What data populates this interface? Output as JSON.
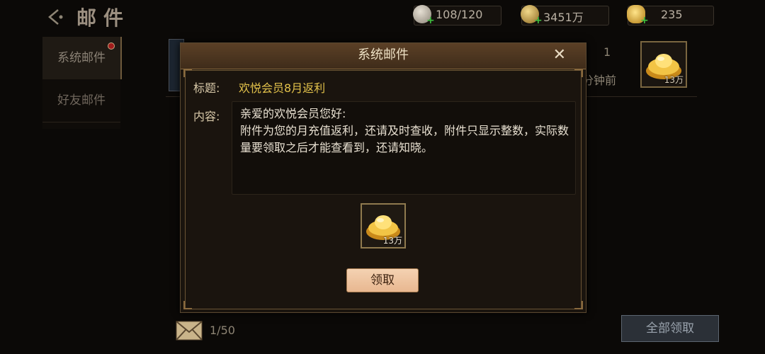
{
  "header": {
    "title": "邮件"
  },
  "resources": [
    {
      "name": "stone",
      "icon": "stone-icon",
      "value": "108/120",
      "color": "#bdb6a8"
    },
    {
      "name": "copper",
      "icon": "coin-icon",
      "value": "3451万",
      "color": "#c8a24a"
    },
    {
      "name": "gold",
      "icon": "gold-ingot-icon",
      "value": "235",
      "color": "#e0b43a"
    }
  ],
  "sidebar": {
    "items": [
      {
        "label": "系统邮件",
        "active": true,
        "has_notice": true
      },
      {
        "label": "好友邮件",
        "active": false,
        "has_notice": false
      }
    ]
  },
  "mail_list": {
    "count": "1",
    "time": "分钟前",
    "item_qty": "13万"
  },
  "footer": {
    "mail_count": "1/50",
    "claim_all_label": "全部领取"
  },
  "dialog": {
    "title": "系统邮件",
    "close_symbol": "✕",
    "subject_label": "标题:",
    "subject": "欢悦会员8月返利",
    "content_label": "内容:",
    "content": "亲爱的欢悦会员您好:\n附件为您的月充值返利，还请及时查收，附件只显示整数，实际数量要领取之后才能查看到，还请知晓。",
    "attachment": {
      "icon": "gold-ingot-icon",
      "qty": "13万"
    },
    "claim_label": "领取"
  },
  "colors": {
    "accent": "#e3c24b",
    "button": "#f0c9a6",
    "panel": "#1a140e"
  }
}
